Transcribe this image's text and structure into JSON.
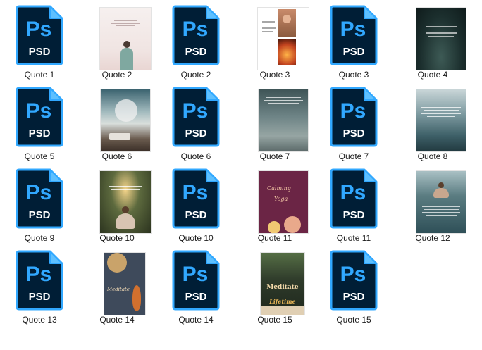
{
  "items": [
    {
      "type": "psd",
      "name": "Quote 1",
      "badge": "PSD",
      "logo": "Ps"
    },
    {
      "type": "image",
      "name": "Quote 2",
      "thumb": "woman-pink"
    },
    {
      "type": "psd",
      "name": "Quote 2",
      "badge": "PSD",
      "logo": "Ps"
    },
    {
      "type": "image",
      "name": "Quote 3",
      "thumb": "collage-candles"
    },
    {
      "type": "psd",
      "name": "Quote 3",
      "badge": "PSD",
      "logo": "Ps"
    },
    {
      "type": "image",
      "name": "Quote 4",
      "thumb": "dark-green"
    },
    {
      "type": "psd",
      "name": "Quote 5",
      "badge": "PSD",
      "logo": "Ps"
    },
    {
      "type": "image",
      "name": "Quote 6",
      "thumb": "cloud-sky"
    },
    {
      "type": "psd",
      "name": "Quote 6",
      "badge": "PSD",
      "logo": "Ps"
    },
    {
      "type": "image",
      "name": "Quote 7",
      "thumb": "water-grey"
    },
    {
      "type": "psd",
      "name": "Quote 7",
      "badge": "PSD",
      "logo": "Ps"
    },
    {
      "type": "image",
      "name": "Quote 8",
      "thumb": "ocean-teal"
    },
    {
      "type": "psd",
      "name": "Quote 9",
      "badge": "PSD",
      "logo": "Ps"
    },
    {
      "type": "image",
      "name": "Quote 10",
      "thumb": "yoga-forest"
    },
    {
      "type": "psd",
      "name": "Quote 10",
      "badge": "PSD",
      "logo": "Ps"
    },
    {
      "type": "image",
      "name": "Quote 11",
      "thumb": "maroon-calming"
    },
    {
      "type": "psd",
      "name": "Quote 11",
      "badge": "PSD",
      "logo": "Ps"
    },
    {
      "type": "image",
      "name": "Quote 12",
      "thumb": "teal-yoga"
    },
    {
      "type": "psd",
      "name": "Quote 13",
      "badge": "PSD",
      "logo": "Ps"
    },
    {
      "type": "image",
      "name": "Quote 14",
      "thumb": "meditate-orange"
    },
    {
      "type": "psd",
      "name": "Quote 14",
      "badge": "PSD",
      "logo": "Ps"
    },
    {
      "type": "image",
      "name": "Quote 15",
      "thumb": "lifetime-green"
    },
    {
      "type": "psd",
      "name": "Quote 15",
      "badge": "PSD",
      "logo": "Ps"
    }
  ],
  "thumb_text": {
    "calming": "Calming",
    "yoga": "Yoga",
    "meditate": "Meditate",
    "meditate_script": "Meditate",
    "lifetime": "Lifetime"
  },
  "colors": {
    "ps_dark": "#001e36",
    "ps_blue": "#31a8ff",
    "ps_fold": "#5ec0ff"
  }
}
